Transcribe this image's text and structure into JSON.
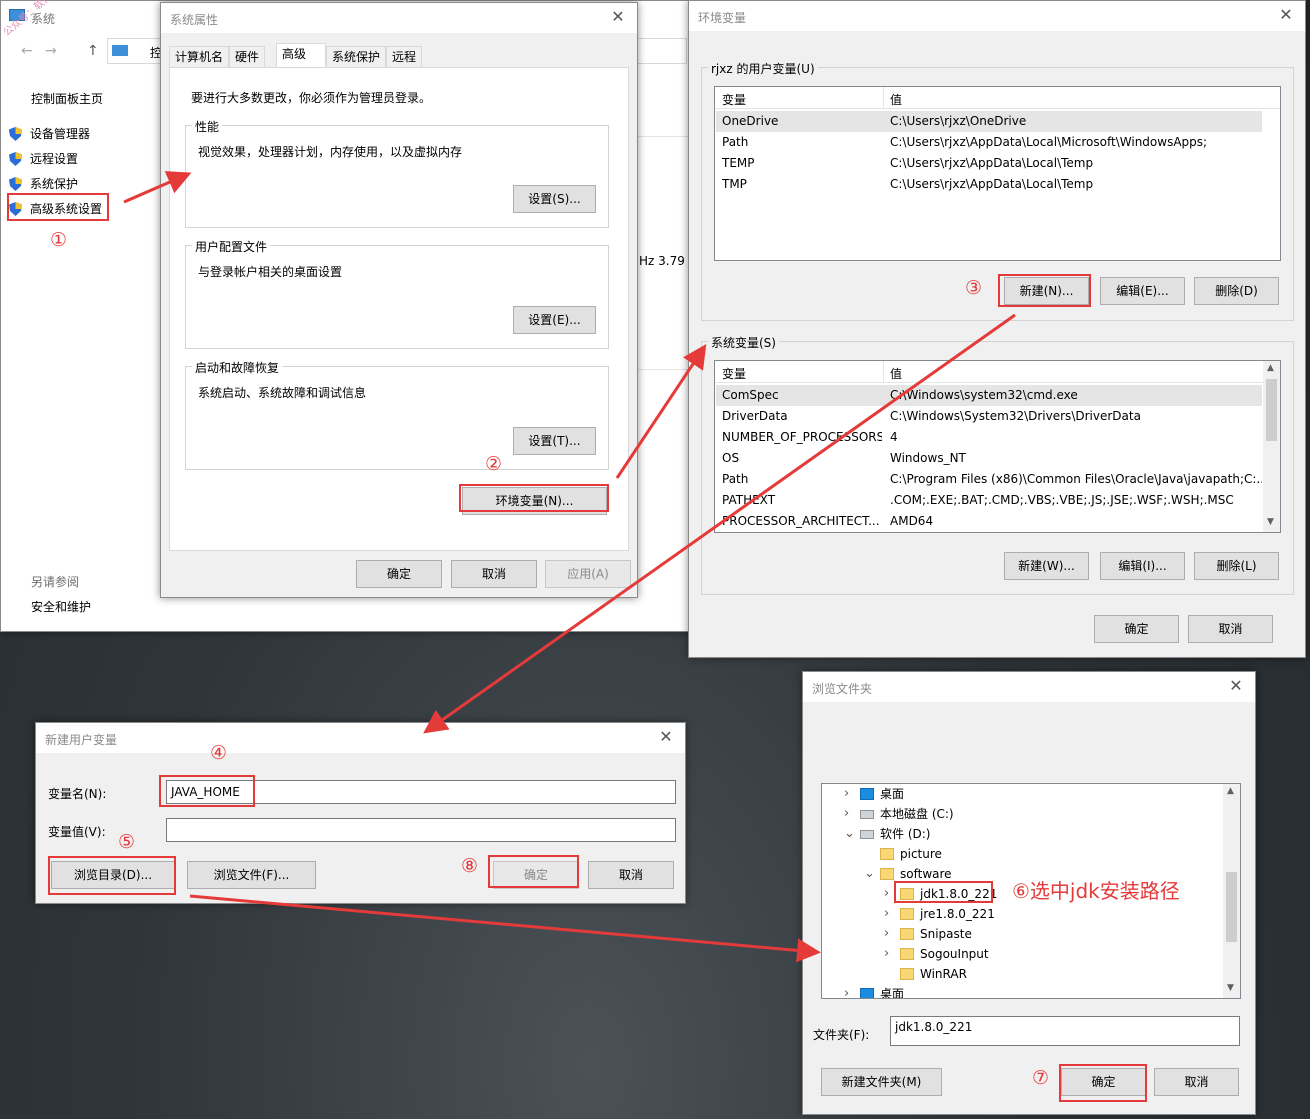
{
  "watermark": "公众号：软件测评",
  "system_window": {
    "title": "系统",
    "address_prefix": "控",
    "sidebar_home": "控制面板主页",
    "items": [
      "设备管理器",
      "远程设置",
      "系统保护",
      "高级系统设置"
    ],
    "see_also": "另请参阅",
    "security": "安全和维护",
    "cpu_fragment": "Hz   3.79"
  },
  "sysprops": {
    "title": "系统属性",
    "tabs": [
      "计算机名",
      "硬件",
      "高级",
      "系统保护",
      "远程"
    ],
    "admin_note": "要进行大多数更改，你必须作为管理员登录。",
    "perf_label": "性能",
    "perf_desc": "视觉效果，处理器计划，内存使用，以及虚拟内存",
    "perf_btn": "设置(S)...",
    "profile_label": "用户配置文件",
    "profile_desc": "与登录帐户相关的桌面设置",
    "profile_btn": "设置(E)...",
    "startup_label": "启动和故障恢复",
    "startup_desc": "系统启动、系统故障和调试信息",
    "startup_btn": "设置(T)...",
    "envvars_btn": "环境变量(N)...",
    "ok": "确定",
    "cancel": "取消",
    "apply": "应用(A)"
  },
  "envvars": {
    "title": "环境变量",
    "user_group": "rjxz 的用户变量(U)",
    "col_var": "变量",
    "col_val": "值",
    "user_vars": [
      {
        "name": "OneDrive",
        "value": "C:\\Users\\rjxz\\OneDrive"
      },
      {
        "name": "Path",
        "value": "C:\\Users\\rjxz\\AppData\\Local\\Microsoft\\WindowsApps;"
      },
      {
        "name": "TEMP",
        "value": "C:\\Users\\rjxz\\AppData\\Local\\Temp"
      },
      {
        "name": "TMP",
        "value": "C:\\Users\\rjxz\\AppData\\Local\\Temp"
      }
    ],
    "user_new": "新建(N)...",
    "user_edit": "编辑(E)...",
    "user_delete": "删除(D)",
    "sys_group": "系统变量(S)",
    "sys_vars": [
      {
        "name": "ComSpec",
        "value": "C:\\Windows\\system32\\cmd.exe"
      },
      {
        "name": "DriverData",
        "value": "C:\\Windows\\System32\\Drivers\\DriverData"
      },
      {
        "name": "NUMBER_OF_PROCESSORS",
        "value": "4"
      },
      {
        "name": "OS",
        "value": "Windows_NT"
      },
      {
        "name": "Path",
        "value": "C:\\Program Files (x86)\\Common Files\\Oracle\\Java\\javapath;C:..."
      },
      {
        "name": "PATHEXT",
        "value": ".COM;.EXE;.BAT;.CMD;.VBS;.VBE;.JS;.JSE;.WSF;.WSH;.MSC"
      },
      {
        "name": "PROCESSOR_ARCHITECT...",
        "value": "AMD64"
      }
    ],
    "sys_new": "新建(W)...",
    "sys_edit": "编辑(I)...",
    "sys_delete": "删除(L)",
    "ok": "确定",
    "cancel": "取消"
  },
  "newvar": {
    "title": "新建用户变量",
    "name_label": "变量名(N):",
    "name_value": "JAVA_HOME",
    "value_label": "变量值(V):",
    "value_value": "",
    "browse_dir": "浏览目录(D)...",
    "browse_file": "浏览文件(F)...",
    "ok": "确定",
    "cancel": "取消"
  },
  "browse": {
    "title": "浏览文件夹",
    "tree": [
      {
        "label": "桌面",
        "level": 0,
        "expander": "›",
        "kind": "desktop"
      },
      {
        "label": "本地磁盘 (C:)",
        "level": 0,
        "expander": "›",
        "kind": "drive"
      },
      {
        "label": "软件 (D:)",
        "level": 0,
        "expander": "⌄",
        "kind": "drive"
      },
      {
        "label": "picture",
        "level": 1,
        "expander": "",
        "kind": "folder"
      },
      {
        "label": "software",
        "level": 1,
        "expander": "⌄",
        "kind": "folder"
      },
      {
        "label": "jdk1.8.0_221",
        "level": 2,
        "expander": "›",
        "kind": "folder"
      },
      {
        "label": "jre1.8.0_221",
        "level": 2,
        "expander": "›",
        "kind": "folder"
      },
      {
        "label": "Snipaste",
        "level": 2,
        "expander": "›",
        "kind": "folder"
      },
      {
        "label": "SogouInput",
        "level": 2,
        "expander": "›",
        "kind": "folder"
      },
      {
        "label": "WinRAR",
        "level": 2,
        "expander": "",
        "kind": "folder"
      },
      {
        "label": "桌面",
        "level": 0,
        "expander": "›",
        "kind": "desktop"
      }
    ],
    "folder_label": "文件夹(F):",
    "folder_value": "jdk1.8.0_221",
    "new_folder": "新建文件夹(M)",
    "ok": "确定",
    "cancel": "取消"
  },
  "annotations": {
    "n1": "①",
    "n2": "②",
    "n3": "③",
    "n4": "④",
    "n5": "⑤",
    "n6": "⑥选中jdk安装路径",
    "n7": "⑦",
    "n8": "⑧"
  },
  "colors": {
    "annotation_red": "#e53a3a",
    "selected_row": "#e5e5e5",
    "folder_yellow": "#f8d775"
  }
}
